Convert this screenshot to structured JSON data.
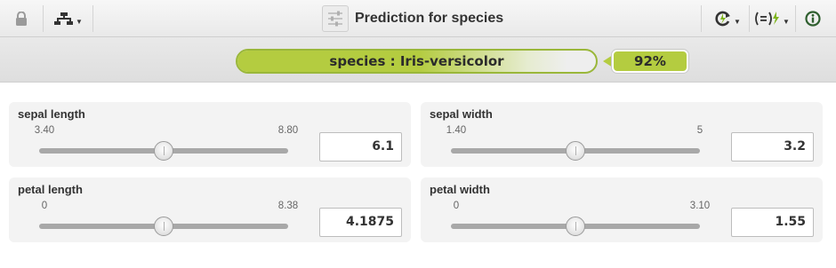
{
  "header": {
    "title": "Prediction for species",
    "icons": {
      "lock": "lock-icon",
      "tree": "tree-model-icon",
      "model": "model-settings-icon",
      "reload": "reload-icon",
      "formula": "formula-icon",
      "info": "info-icon"
    }
  },
  "prediction": {
    "label": "species : Iris-versicolor",
    "confidence_text": "92%",
    "confidence": 0.92
  },
  "fields": [
    {
      "name": "sepal length",
      "min_label": "3.40",
      "max_label": "8.80",
      "min": 3.4,
      "max": 8.8,
      "value": 6.1,
      "value_text": "6.1"
    },
    {
      "name": "sepal width",
      "min_label": "1.40",
      "max_label": "5",
      "min": 1.4,
      "max": 5,
      "value": 3.2,
      "value_text": "3.2"
    },
    {
      "name": "petal length",
      "min_label": "0",
      "max_label": "8.38",
      "min": 0,
      "max": 8.38,
      "value": 4.1875,
      "value_text": "4.1875"
    },
    {
      "name": "petal width",
      "min_label": "0",
      "max_label": "3.10",
      "min": 0,
      "max": 3.1,
      "value": 1.55,
      "value_text": "1.55"
    }
  ],
  "colors": {
    "accent": "#b4cc40",
    "accent_border": "#9ab73a",
    "info": "#2f5f2f"
  }
}
